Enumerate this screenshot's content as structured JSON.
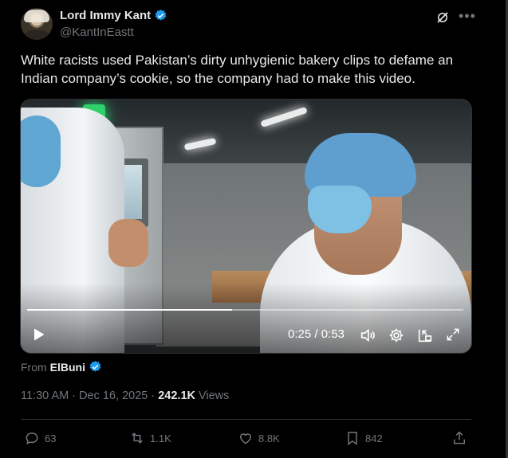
{
  "author": {
    "name": "Lord Immy Kant",
    "handle": "@KantInEastt"
  },
  "tweet": {
    "text": "White racists used Pakistan’s dirty unhygienic bakery clips to defame an Indian company’s cookie, so the company had to make this video."
  },
  "video": {
    "time": "0:25 / 0:53",
    "progress": 0.47
  },
  "source": {
    "prefix": "From",
    "name": "ElBuni"
  },
  "meta": {
    "timestamp": "11:30 AM · Dec 16, 2025 · ",
    "views_count": "242.1K",
    "views_label": " Views"
  },
  "actions": {
    "replies": "63",
    "reposts": "1.1K",
    "likes": "8.8K",
    "bookmarks": "842"
  },
  "colors": {
    "background": "#000000",
    "text": "#e7e9ea",
    "muted": "#71767b",
    "verified": "#1d9bf0",
    "divider": "#2f3336"
  }
}
